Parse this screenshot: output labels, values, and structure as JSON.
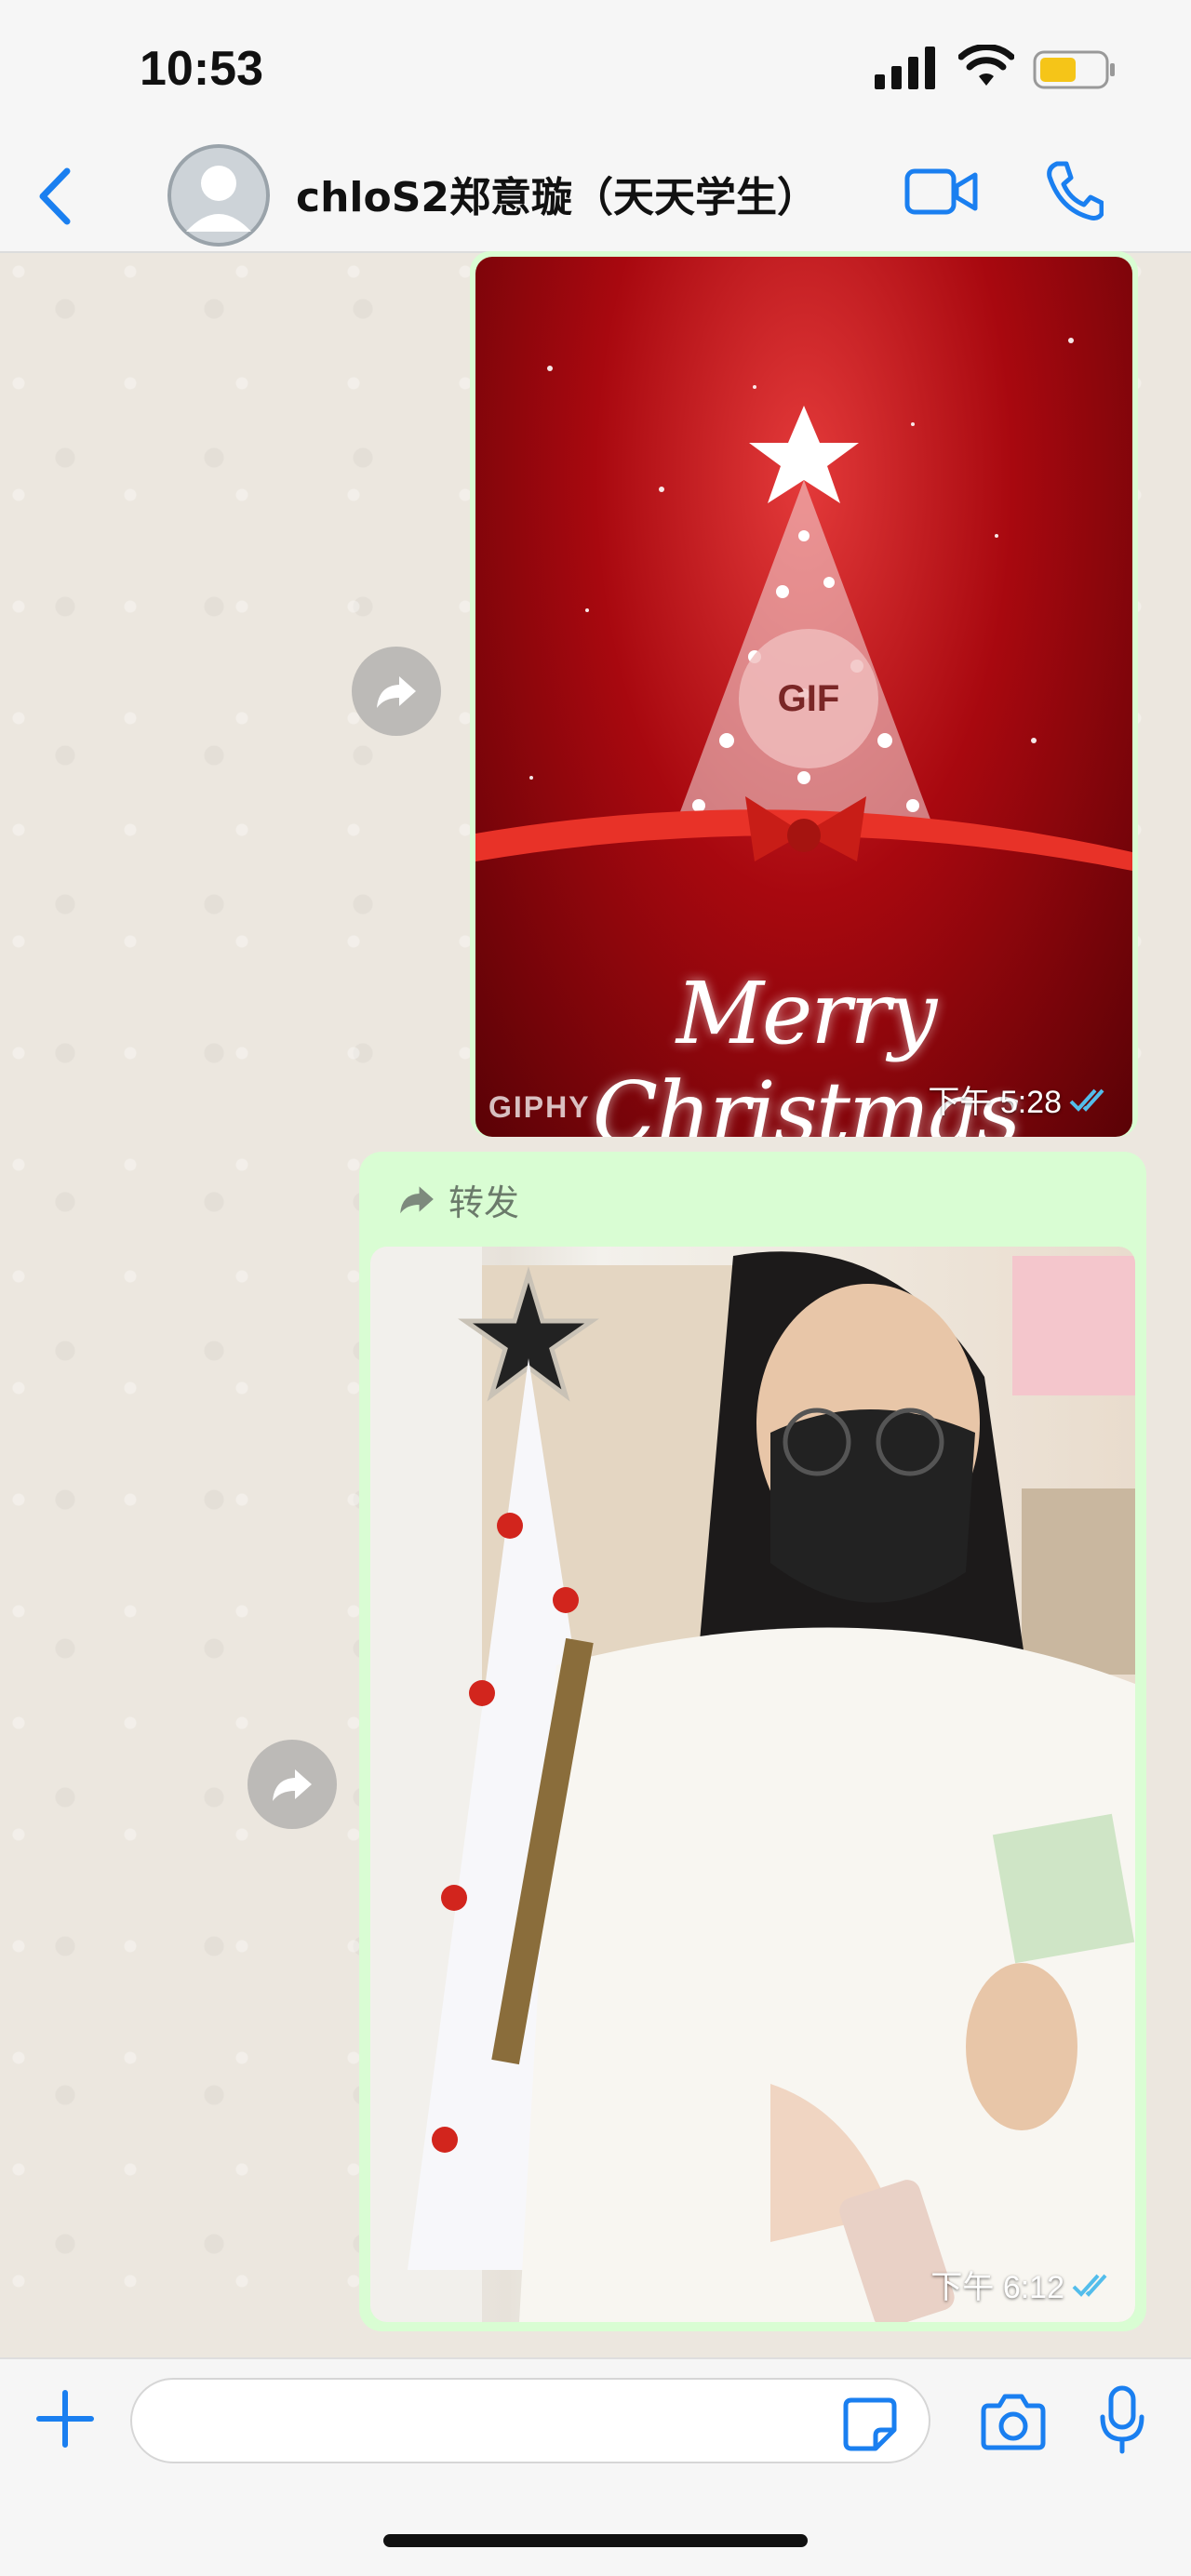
{
  "status_bar": {
    "time": "10:53",
    "battery_color": "#f5c518"
  },
  "header": {
    "contact_name": "chloS2郑意璇（天天学生）",
    "back_icon": "chevron-left-icon",
    "video_icon": "video-camera-icon",
    "call_icon": "phone-icon",
    "accent_color": "#1a7ff0"
  },
  "messages": [
    {
      "type": "gif",
      "badge": "GIF",
      "caption": "Merry Christmas",
      "source": "GIPHY",
      "time": "下午 5:28",
      "status": "read"
    },
    {
      "type": "photo",
      "forwarded_label": "转发",
      "time": "下午 6:12",
      "status": "read"
    }
  ],
  "composer": {
    "placeholder": "",
    "icons": [
      "plus-icon",
      "sticker-icon",
      "camera-icon",
      "microphone-icon"
    ]
  },
  "colors": {
    "bubble_outgoing": "#d9fdd3",
    "read_check": "#53bdeb"
  }
}
